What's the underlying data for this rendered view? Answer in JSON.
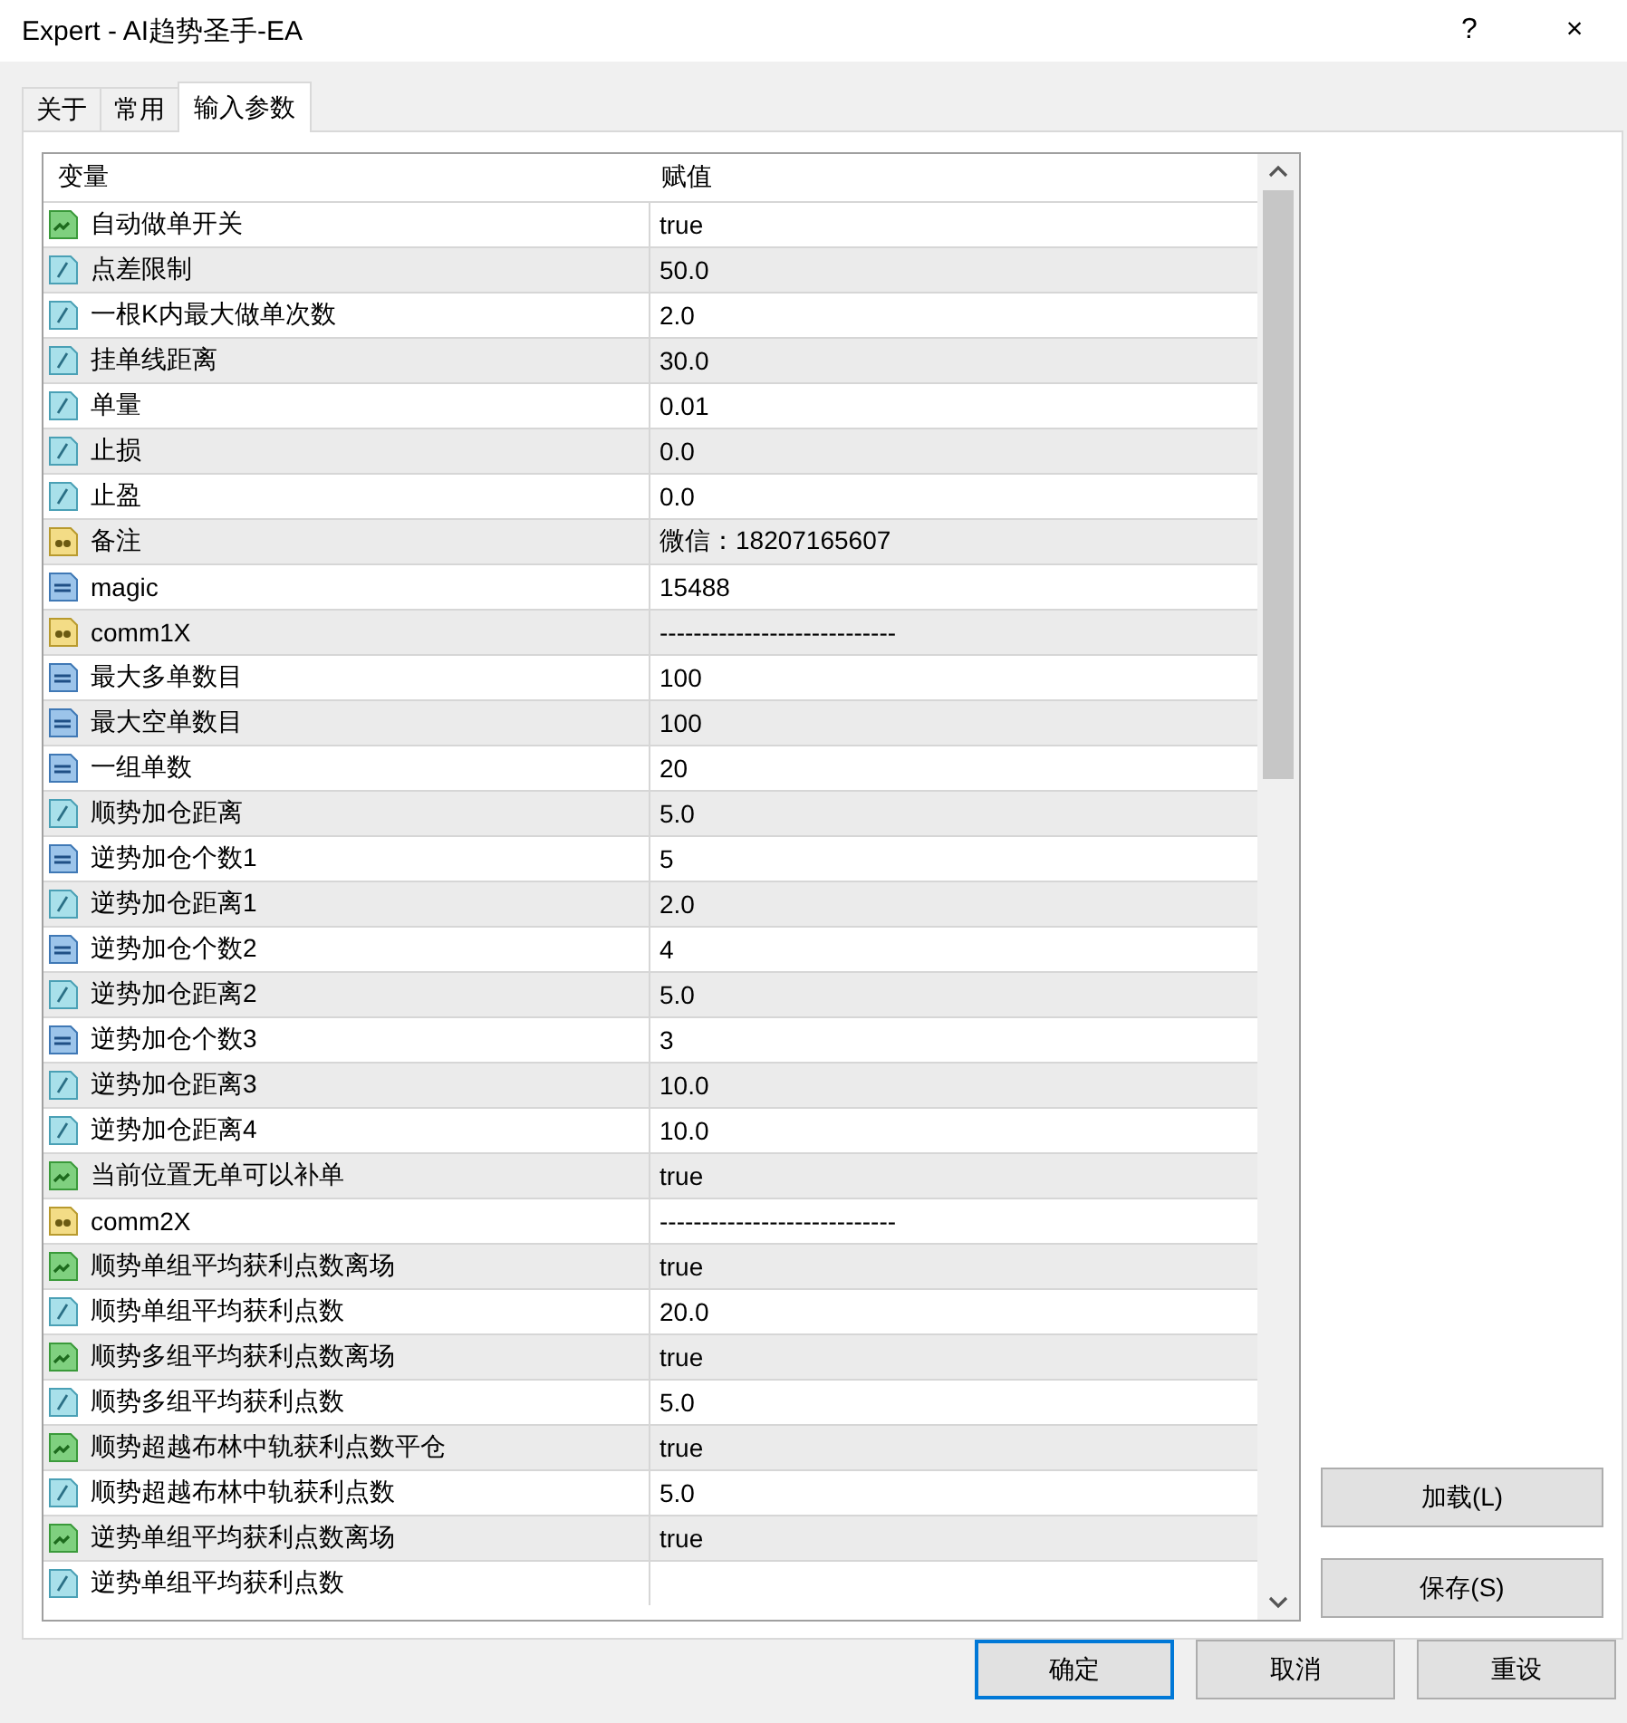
{
  "window": {
    "title": "Expert - AI趋势圣手-EA",
    "help": "?",
    "close": "×"
  },
  "tabs": [
    {
      "label": "关于",
      "selected": false
    },
    {
      "label": "常用",
      "selected": false
    },
    {
      "label": "输入参数",
      "selected": true
    }
  ],
  "table": {
    "columns": [
      "变量",
      "赋值"
    ],
    "rows": [
      {
        "kind": "bool",
        "name": "自动做单开关",
        "value": "true"
      },
      {
        "kind": "double",
        "name": "点差限制",
        "value": "50.0"
      },
      {
        "kind": "double",
        "name": "一根K内最大做单次数",
        "value": "2.0"
      },
      {
        "kind": "double",
        "name": "挂单线距离",
        "value": "30.0"
      },
      {
        "kind": "double",
        "name": "单量",
        "value": "0.01"
      },
      {
        "kind": "double",
        "name": "止损",
        "value": "0.0"
      },
      {
        "kind": "double",
        "name": "止盈",
        "value": "0.0"
      },
      {
        "kind": "string",
        "name": "备注",
        "value": "微信：18207165607"
      },
      {
        "kind": "int",
        "name": "magic",
        "value": "15488"
      },
      {
        "kind": "string",
        "name": "comm1X",
        "value": "----------------------------"
      },
      {
        "kind": "int",
        "name": "最大多单数目",
        "value": "100"
      },
      {
        "kind": "int",
        "name": "最大空单数目",
        "value": "100"
      },
      {
        "kind": "int",
        "name": "一组单数",
        "value": "20"
      },
      {
        "kind": "double",
        "name": "顺势加仓距离",
        "value": "5.0"
      },
      {
        "kind": "int",
        "name": "逆势加仓个数1",
        "value": "5"
      },
      {
        "kind": "double",
        "name": "逆势加仓距离1",
        "value": "2.0"
      },
      {
        "kind": "int",
        "name": "逆势加仓个数2",
        "value": "4"
      },
      {
        "kind": "double",
        "name": "逆势加仓距离2",
        "value": "5.0"
      },
      {
        "kind": "int",
        "name": "逆势加仓个数3",
        "value": "3"
      },
      {
        "kind": "double",
        "name": "逆势加仓距离3",
        "value": "10.0"
      },
      {
        "kind": "double",
        "name": "逆势加仓距离4",
        "value": "10.0"
      },
      {
        "kind": "bool",
        "name": "当前位置无单可以补单",
        "value": "true"
      },
      {
        "kind": "string",
        "name": "comm2X",
        "value": "----------------------------"
      },
      {
        "kind": "bool",
        "name": "顺势单组平均获利点数离场",
        "value": "true"
      },
      {
        "kind": "double",
        "name": "顺势单组平均获利点数",
        "value": "20.0"
      },
      {
        "kind": "bool",
        "name": "顺势多组平均获利点数离场",
        "value": "true"
      },
      {
        "kind": "double",
        "name": "顺势多组平均获利点数",
        "value": "5.0"
      },
      {
        "kind": "bool",
        "name": "顺势超越布林中轨获利点数平仓",
        "value": "true"
      },
      {
        "kind": "double",
        "name": "顺势超越布林中轨获利点数",
        "value": "5.0"
      },
      {
        "kind": "bool",
        "name": "逆势单组平均获利点数离场",
        "value": "true"
      },
      {
        "kind": "double",
        "name": "逆势单组平均获利点数"
      }
    ]
  },
  "side_buttons": [
    "加载(L)",
    "保存(S)"
  ],
  "buttons": [
    {
      "label": "确定",
      "default": true
    },
    {
      "label": "取消",
      "default": false
    },
    {
      "label": "重设",
      "default": false
    }
  ]
}
